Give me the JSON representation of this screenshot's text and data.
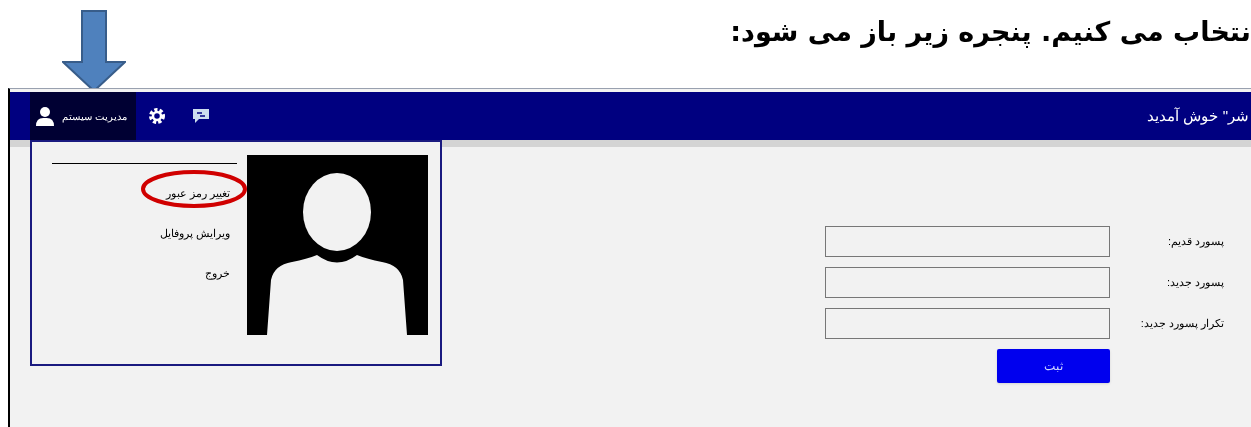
{
  "document_heading": "نتخاب می کنیم.  پنجره زیر باز می شود:",
  "navbar": {
    "welcome": "شر\" خوش آمدید",
    "user_menu": {
      "label": "مدیریت سیستم",
      "open": true
    }
  },
  "dropdown": {
    "items": [
      {
        "label": "تغییر رمز عبور",
        "highlighted": true
      },
      {
        "label": "ویرایش پروفایل",
        "highlighted": false
      },
      {
        "label": "خروج",
        "highlighted": false
      }
    ]
  },
  "form": {
    "fields": [
      {
        "label": "پسورد قدیم:"
      },
      {
        "label": "پسورد جدید:"
      },
      {
        "label": "تکرار پسورد جدید:"
      }
    ],
    "submit": "ثبت"
  }
}
